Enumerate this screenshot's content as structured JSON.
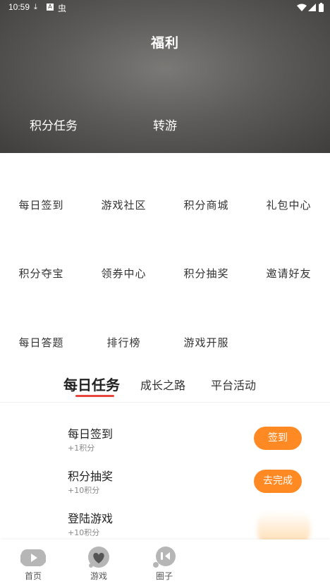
{
  "status_bar": {
    "time": "10:59",
    "icons": [
      "download-icon",
      "a-icon",
      "bug-icon"
    ],
    "bug_glyph": "虫"
  },
  "header": {
    "title": "福利",
    "tabs": [
      {
        "label": "积分任务"
      },
      {
        "label": "转游"
      }
    ]
  },
  "grid": {
    "items": [
      {
        "label": "每日签到"
      },
      {
        "label": "游戏社区"
      },
      {
        "label": "积分商城"
      },
      {
        "label": "礼包中心"
      },
      {
        "label": "积分夺宝"
      },
      {
        "label": "领券中心"
      },
      {
        "label": "积分抽奖"
      },
      {
        "label": "邀请好友"
      },
      {
        "label": "每日答题"
      },
      {
        "label": "排行榜"
      },
      {
        "label": "游戏开服"
      }
    ]
  },
  "sections": {
    "tabs": [
      {
        "label": "每日任务",
        "active": true
      },
      {
        "label": "成长之路"
      },
      {
        "label": "平台活动"
      }
    ]
  },
  "tasks": [
    {
      "title": "每日签到",
      "points": "+1积分",
      "button": "签到"
    },
    {
      "title": "积分抽奖",
      "points": "+10积分",
      "button": "去完成"
    },
    {
      "title": "登陆游戏",
      "points": "+10积分",
      "button": ""
    }
  ],
  "bottom_nav": {
    "items": [
      {
        "label": "首页",
        "icon": "home-game-icon"
      },
      {
        "label": "游戏",
        "icon": "heart-game-icon"
      },
      {
        "label": "圈子",
        "icon": "circle-chat-icon"
      }
    ]
  },
  "colors": {
    "accent": "#ff8a23",
    "tab_underline": "#e8453c",
    "header_dark": "#3f3e3c",
    "nav_icon": "#b6b6b6"
  }
}
